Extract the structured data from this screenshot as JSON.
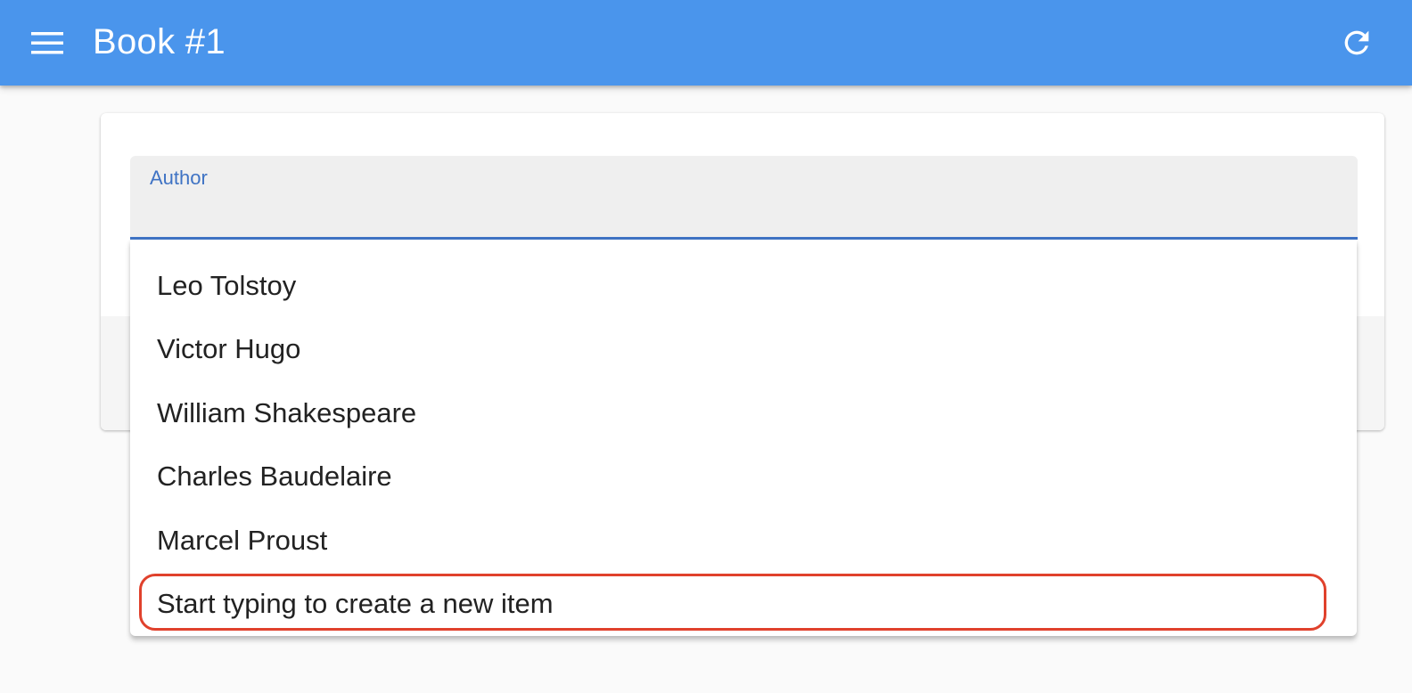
{
  "colors": {
    "appbar": "#4a95ec",
    "accent": "#3f73c4",
    "highlight": "#e0412c"
  },
  "appbar": {
    "title": "Book #1",
    "menu_icon": "menu-icon",
    "refresh_icon": "refresh-icon"
  },
  "form": {
    "author": {
      "label": "Author",
      "value": ""
    }
  },
  "dropdown": {
    "options": [
      {
        "label": "Leo Tolstoy"
      },
      {
        "label": "Victor Hugo"
      },
      {
        "label": "William Shakespeare"
      },
      {
        "label": "Charles Baudelaire"
      },
      {
        "label": "Marcel Proust"
      },
      {
        "label": "Start typing to create a new item",
        "highlighted": true
      }
    ]
  }
}
